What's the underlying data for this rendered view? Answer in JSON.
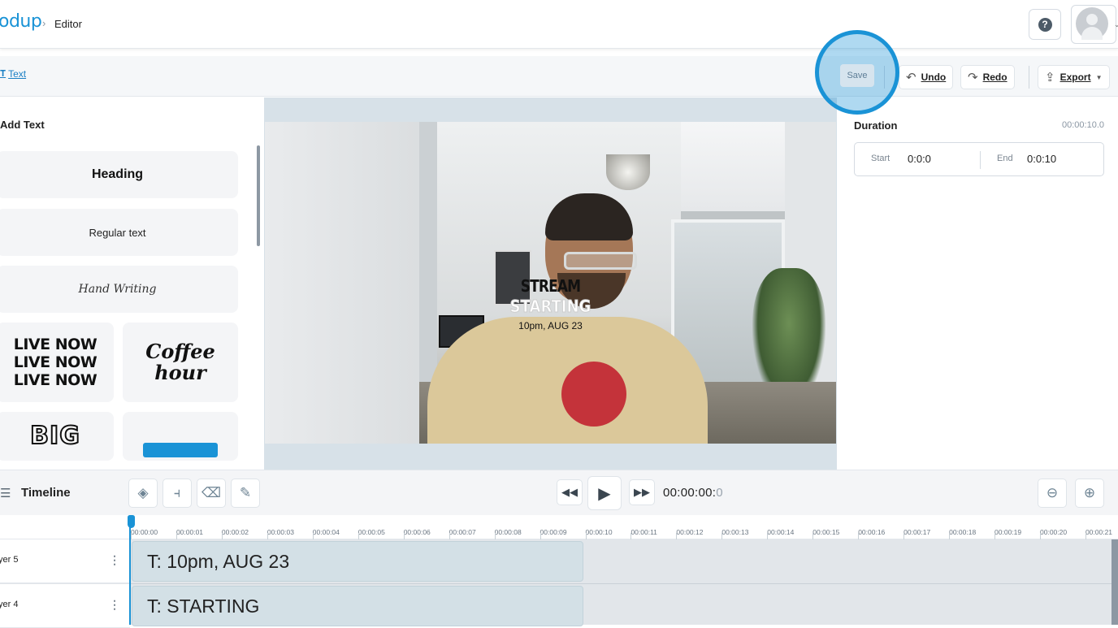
{
  "header": {
    "brand": "odup",
    "breadcrumb_sep": "›",
    "breadcrumb": "Editor",
    "help_icon": "question-icon",
    "avatar_icon": "user-avatar-icon"
  },
  "toolbar": {
    "text_tab": "Text",
    "save": "Save",
    "undo": "Undo",
    "redo": "Redo",
    "export": "Export"
  },
  "left_panel": {
    "title": "Add Text",
    "options": {
      "heading": "Heading",
      "regular": "Regular text",
      "handwriting": "Hand Writing",
      "live_now": [
        "LIVE NOW",
        "LIVE NOW",
        "LIVE NOW"
      ],
      "coffee": [
        "Coffee",
        "hour"
      ],
      "big": "BIG"
    }
  },
  "canvas": {
    "overlay_line1": "STREAM",
    "overlay_line2": "STARTING",
    "overlay_line3": "10pm, AUG 23"
  },
  "properties": {
    "duration_label": "Duration",
    "duration_value": "00:00:10.0",
    "start_label": "Start",
    "start_value": "0:0:0",
    "end_label": "End",
    "end_value": "0:0:10"
  },
  "timeline": {
    "title": "Timeline",
    "timecode_main": "00:00:00:",
    "timecode_frame": "0",
    "ticks": [
      "00:00:00",
      "00:00:01",
      "00:00:02",
      "00:00:03",
      "00:00:04",
      "00:00:05",
      "00:00:06",
      "00:00:07",
      "00:00:08",
      "00:00:09",
      "00:00:10",
      "00:00:11",
      "00:00:12",
      "00:00:13",
      "00:00:14",
      "00:00:15",
      "00:00:16",
      "00:00:17",
      "00:00:18",
      "00:00:19",
      "00:00:20",
      "00:00:21"
    ],
    "tracks": [
      {
        "name": "yer 5",
        "clip": "T: 10pm, AUG 23"
      },
      {
        "name": "yer 4",
        "clip": "T: STARTING"
      }
    ]
  },
  "colors": {
    "accent": "#1a93d6",
    "clip_fill": "#d3e0e6",
    "stage_bg": "#d7e1e8"
  }
}
